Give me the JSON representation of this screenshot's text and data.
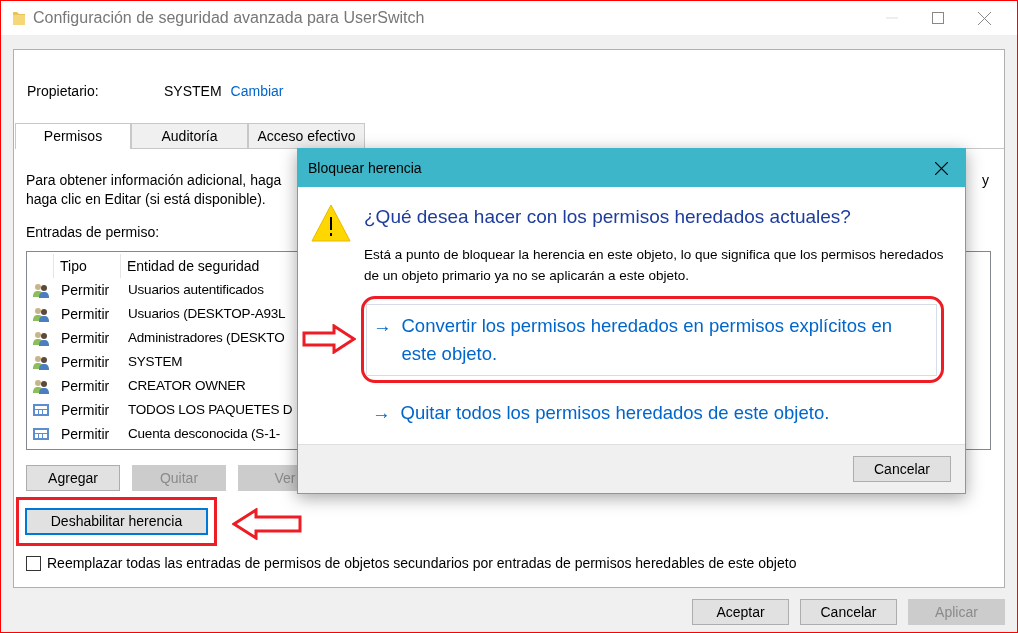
{
  "window": {
    "title": "Configuración de seguridad avanzada para UserSwitch"
  },
  "owner": {
    "label": "Propietario:",
    "value": "SYSTEM",
    "link": "Cambiar"
  },
  "tabs": [
    {
      "label": "Permisos",
      "selected": true
    },
    {
      "label": "Auditoría",
      "selected": false
    },
    {
      "label": "Acceso efectivo",
      "selected": false
    }
  ],
  "info_text": {
    "line_1": "Para obtener información adicional, haga",
    "line_1_end": "y",
    "line_2": "haga clic en Editar (si está disponible)."
  },
  "entries_label": "Entradas de permiso:",
  "table": {
    "columns": [
      "Tipo",
      "Entidad de seguridad"
    ],
    "rows": [
      {
        "kind": "group",
        "type": "Permitir",
        "entity": "Usuarios autentificados"
      },
      {
        "kind": "group",
        "type": "Permitir",
        "entity": "Usuarios (DESKTOP-A93L"
      },
      {
        "kind": "group",
        "type": "Permitir",
        "entity": "Administradores (DESKTO"
      },
      {
        "kind": "group",
        "type": "Permitir",
        "entity": "SYSTEM"
      },
      {
        "kind": "group",
        "type": "Permitir",
        "entity": "CREATOR OWNER"
      },
      {
        "kind": "app",
        "type": "Permitir",
        "entity": "TODOS LOS PAQUETES D"
      },
      {
        "kind": "app",
        "type": "Permitir",
        "entity": "Cuenta desconocida (S-1-"
      }
    ]
  },
  "entry_buttons": [
    {
      "label": "Agregar",
      "disabled": false
    },
    {
      "label": "Quitar",
      "disabled": true
    },
    {
      "label": "Ver",
      "disabled": true
    }
  ],
  "disable_inheritance_button": {
    "label": "Deshabilitar herencia",
    "focused": true
  },
  "replace_checkbox": {
    "label": "Reemplazar todas las entradas de permisos de objetos secundarios por entradas de permisos heredables de este objeto",
    "checked": false
  },
  "footer_buttons": [
    {
      "label": "Aceptar",
      "disabled": false
    },
    {
      "label": "Cancelar",
      "disabled": false
    },
    {
      "label": "Aplicar",
      "disabled": true
    }
  ],
  "dialog": {
    "title": "Bloquear herencia",
    "heading": "¿Qué desea hacer con los permisos heredados actuales?",
    "description": "Está a punto de bloquear la herencia en este objeto, lo que significa que los permisos heredados de un objeto primario ya no se aplicarán a este objeto.",
    "options": [
      {
        "arrow": "→",
        "label": "Convertir los permisos heredados en permisos explícitos en este objeto.",
        "highlighted": true
      },
      {
        "arrow": "→",
        "label": "Quitar todos los permisos heredados de este objeto.",
        "highlighted": false
      }
    ],
    "cancel": "Cancelar"
  }
}
